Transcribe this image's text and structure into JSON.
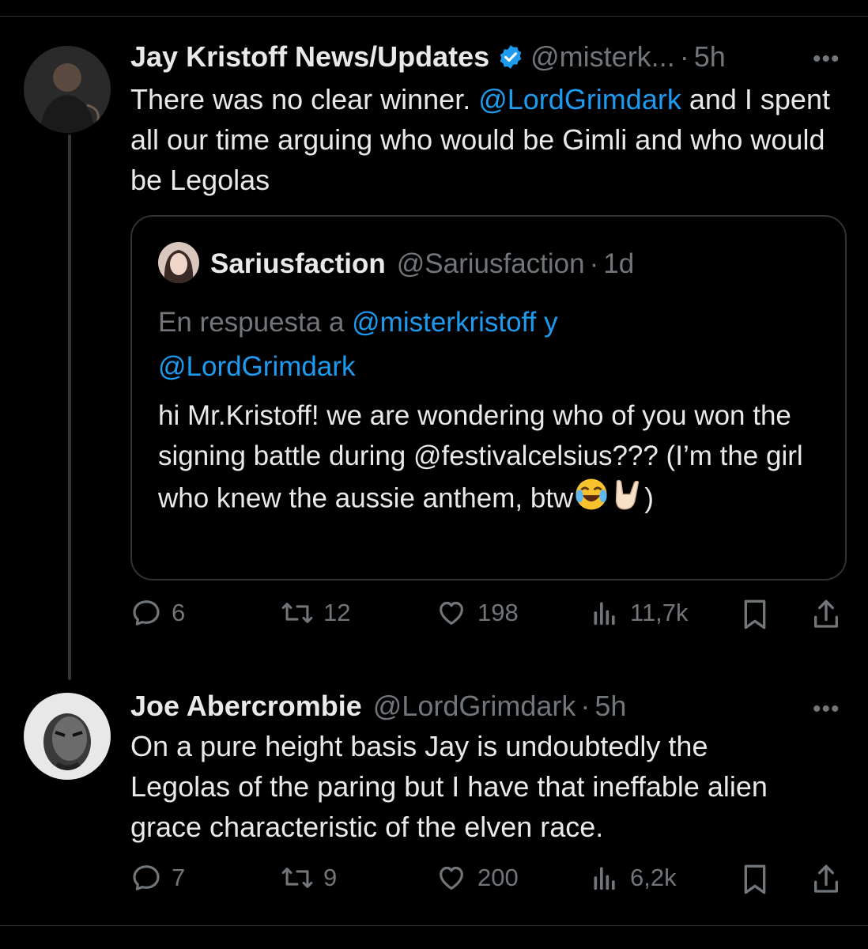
{
  "tweet1": {
    "name": "Jay Kristoff News/Updates",
    "handle": "@misterk...",
    "dot": "·",
    "time": "5h",
    "more": "•••",
    "text_part1": "There was no clear winner. ",
    "mention": "@LordGrimdark",
    "text_part2": " and I spent all our time arguing who would be Gimli and who would be Legolas",
    "quote": {
      "name": "Sariusfaction",
      "handle": "@Sariusfaction",
      "dot": "·",
      "time": "1d",
      "reply_prefix": "En respuesta a ",
      "reply_mention1": "@misterkristoff",
      "reply_y": " y",
      "reply_mention2": "@LordGrimdark",
      "text": "hi Mr.Kristoff! we are wondering who of you won the signing battle during @festivalcelsius??? (I’m the girl who knew the aussie anthem, btw",
      "text_end": ")"
    },
    "actions": {
      "replies": "6",
      "retweets": "12",
      "likes": "198",
      "views": "11,7k"
    }
  },
  "tweet2": {
    "name": "Joe Abercrombie",
    "handle": "@LordGrimdark",
    "dot": "·",
    "time": "5h",
    "more": "•••",
    "text": "On a pure height basis Jay is undoubtedly the Legolas of the paring but I have that ineffable alien grace characteristic of the elven race.",
    "actions": {
      "replies": "7",
      "retweets": "9",
      "likes": "200",
      "views": "6,2k"
    }
  },
  "colors": {
    "accent": "#1d9bf0",
    "muted": "#71767b",
    "text": "#e7e9ea",
    "border": "#2f3336"
  },
  "icons": [
    "reply-icon",
    "retweet-icon",
    "like-icon",
    "views-icon",
    "bookmark-icon",
    "share-icon",
    "verified-badge-icon",
    "laughing-emoji",
    "rock-hand-emoji"
  ]
}
